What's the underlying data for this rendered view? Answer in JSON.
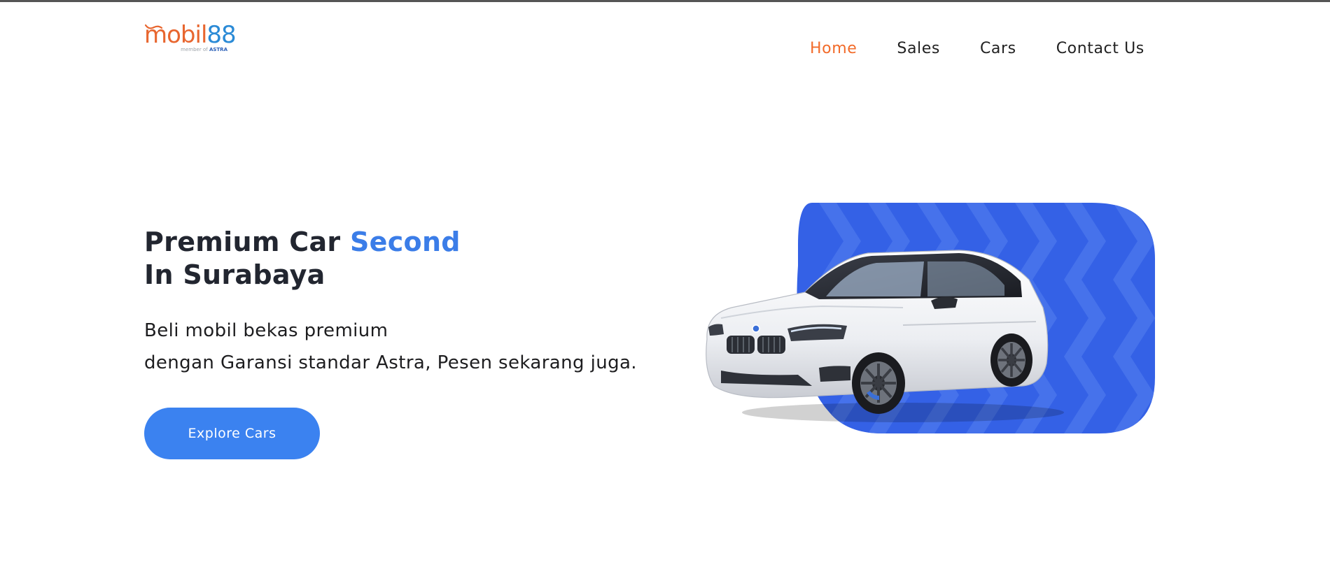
{
  "brand": {
    "logo_text_part1": "mobil",
    "logo_text_part2": "88",
    "logo_sub_prefix": "member of",
    "logo_sub_brand": "ASTRA"
  },
  "nav": {
    "items": [
      {
        "label": "Home",
        "active": true
      },
      {
        "label": "Sales",
        "active": false
      },
      {
        "label": "Cars",
        "active": false
      },
      {
        "label": "Contact Us",
        "active": false
      }
    ]
  },
  "hero": {
    "title_part1": "Premium Car ",
    "title_highlight": "Second",
    "title_line2": "In Surabaya",
    "desc_line1": "Beli mobil bekas premium",
    "desc_line2": "dengan Garansi standar Astra, Pesen sekarang juga.",
    "cta_label": "Explore Cars"
  },
  "colors": {
    "accent_orange": "#f26b2a",
    "accent_blue": "#3b82f0",
    "panel_blue": "#3461e6"
  },
  "icons": [
    "logo-smile-icon"
  ]
}
